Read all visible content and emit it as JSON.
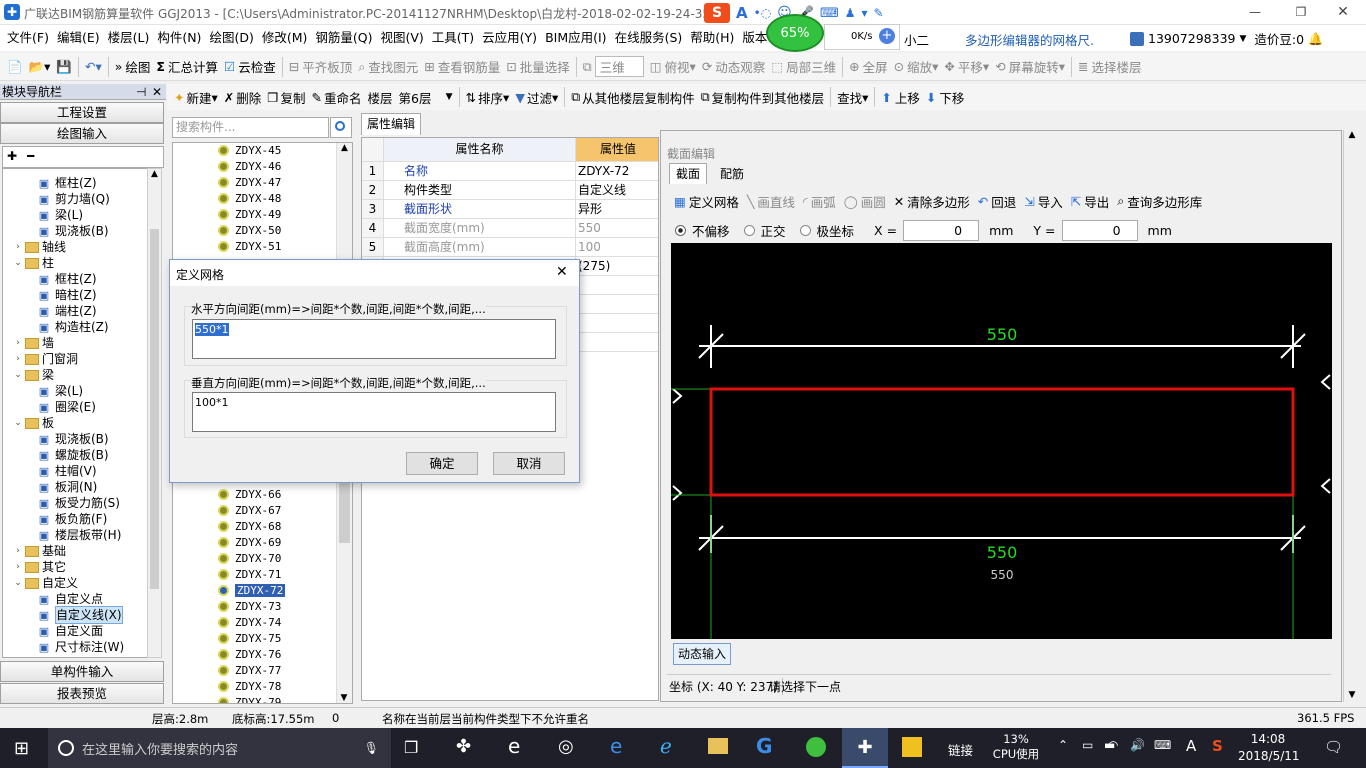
{
  "window": {
    "title": "广联达BIM钢筋算量软件 GGJ2013 - [C:\\Users\\Administrator.PC-20141127NRHM\\Desktop\\白龙村-2018-02-02-19-24-35"
  },
  "overlay": {
    "net_percent": "65%",
    "net_speed": "0K/s",
    "right_text": "多边形编辑器的网格尺.",
    "assistant": "小二"
  },
  "menu": [
    "文件(F)",
    "编辑(E)",
    "楼层(L)",
    "构件(N)",
    "绘图(D)",
    "修改(M)",
    "钢筋量(Q)",
    "视图(V)",
    "工具(T)",
    "云应用(Y)",
    "BIM应用(I)",
    "在线服务(S)",
    "帮助(H)",
    "版本号(B"
  ],
  "account": {
    "phone": "13907298339",
    "price_label": "造价豆:0"
  },
  "toolbar1": {
    "draw": "绘图",
    "sum": "汇总计算",
    "cloud": "云检查",
    "align": "平齐板顶",
    "find": "查找图元",
    "view_steel": "查看钢筋量",
    "batch": "批量选择",
    "view3d": "三维",
    "topview": "俯视",
    "dynamic": "动态观察",
    "local3d": "局部三维",
    "fullscreen": "全屏",
    "zoom": "缩放",
    "pan": "平移",
    "rotate": "屏幕旋转",
    "select_floor": "选择楼层"
  },
  "toolbar2": {
    "new": "新建",
    "delete": "删除",
    "copy": "复制",
    "rename": "重命名",
    "floor_label": "楼层",
    "floor_value": "第6层",
    "sort": "排序",
    "filter": "过滤",
    "copy_from": "从其他楼层复制构件",
    "copy_to": "复制构件到其他楼层",
    "find": "查找",
    "up": "上移",
    "down": "下移"
  },
  "nav": {
    "header": "模块导航栏",
    "btn_settings": "工程设置",
    "btn_draw": "绘图输入",
    "btn_single": "单构件输入",
    "btn_report": "报表预览",
    "tree": [
      {
        "level": 2,
        "label": "框柱(Z)",
        "icon": "column-icon"
      },
      {
        "level": 2,
        "label": "剪力墙(Q)",
        "icon": "wall-icon"
      },
      {
        "level": 2,
        "label": "梁(L)",
        "icon": "beam-icon"
      },
      {
        "level": 2,
        "label": "现浇板(B)",
        "icon": "slab-icon"
      },
      {
        "level": 1,
        "label": "轴线",
        "exp": "›"
      },
      {
        "level": 1,
        "label": "柱",
        "exp": "⌄"
      },
      {
        "level": 2,
        "label": "框柱(Z)",
        "icon": "column-icon"
      },
      {
        "level": 2,
        "label": "暗柱(Z)",
        "icon": "column-icon"
      },
      {
        "level": 2,
        "label": "端柱(Z)",
        "icon": "column-icon"
      },
      {
        "level": 2,
        "label": "构造柱(Z)",
        "icon": "column-icon"
      },
      {
        "level": 1,
        "label": "墙",
        "exp": "›"
      },
      {
        "level": 1,
        "label": "门窗洞",
        "exp": "›"
      },
      {
        "level": 1,
        "label": "梁",
        "exp": "⌄"
      },
      {
        "level": 2,
        "label": "梁(L)",
        "icon": "beam-icon"
      },
      {
        "level": 2,
        "label": "圈梁(E)",
        "icon": "beam-icon"
      },
      {
        "level": 1,
        "label": "板",
        "exp": "⌄"
      },
      {
        "level": 2,
        "label": "现浇板(B)",
        "icon": "slab-icon"
      },
      {
        "level": 2,
        "label": "螺旋板(B)",
        "icon": "slab-icon"
      },
      {
        "level": 2,
        "label": "柱帽(V)",
        "icon": "cap-icon"
      },
      {
        "level": 2,
        "label": "板洞(N)",
        "icon": "hole-icon"
      },
      {
        "level": 2,
        "label": "板受力筋(S)",
        "icon": "rebar-icon"
      },
      {
        "level": 2,
        "label": "板负筋(F)",
        "icon": "rebar-icon"
      },
      {
        "level": 2,
        "label": "楼层板带(H)",
        "icon": "strip-icon"
      },
      {
        "level": 1,
        "label": "基础",
        "exp": "›"
      },
      {
        "level": 1,
        "label": "其它",
        "exp": "›"
      },
      {
        "level": 1,
        "label": "自定义",
        "exp": "⌄"
      },
      {
        "level": 2,
        "label": "自定义点",
        "icon": "point-icon"
      },
      {
        "level": 2,
        "label": "自定义线(X)",
        "icon": "line-icon",
        "selected": true
      },
      {
        "level": 2,
        "label": "自定义面",
        "icon": "face-icon"
      },
      {
        "level": 2,
        "label": "尺寸标注(W)",
        "icon": "dimension-icon"
      }
    ]
  },
  "components": {
    "search_placeholder": "搜索构件...",
    "top_items": [
      "ZDYX-45",
      "ZDYX-46",
      "ZDYX-47",
      "ZDYX-48",
      "ZDYX-49",
      "ZDYX-50",
      "ZDYX-51"
    ],
    "bottom_items": [
      "ZDYX-66",
      "ZDYX-67",
      "ZDYX-68",
      "ZDYX-69",
      "ZDYX-70",
      "ZDYX-71",
      "ZDYX-72",
      "ZDYX-73",
      "ZDYX-74",
      "ZDYX-75",
      "ZDYX-76",
      "ZDYX-77",
      "ZDYX-78",
      "ZDYX-79"
    ],
    "selected": "ZDYX-72"
  },
  "props": {
    "tab": "属性编辑",
    "col_name": "属性名称",
    "col_value": "属性值",
    "rows": [
      {
        "n": "1",
        "k": "名称",
        "v": "ZDYX-72",
        "blue": true
      },
      {
        "n": "2",
        "k": "构件类型",
        "v": "自定义线",
        "blue": false
      },
      {
        "n": "3",
        "k": "截面形状",
        "v": "异形",
        "blue": true
      },
      {
        "n": "4",
        "k": "截面宽度(mm)",
        "v": "550",
        "gray": true
      },
      {
        "n": "5",
        "k": "截面高度(mm)",
        "v": "100",
        "gray": true
      },
      {
        "n": "",
        "k": "",
        "v": "(275)"
      }
    ]
  },
  "section_editor": {
    "title": "截面编辑",
    "tabs": [
      "截面",
      "配筋"
    ],
    "tools": {
      "define_grid": "定义网格",
      "draw_line": "画直线",
      "draw_arc": "画弧",
      "draw_circle": "画圆",
      "clear": "清除多边形",
      "undo": "回退",
      "import": "导入",
      "export": "导出",
      "query": "查询多边形库"
    },
    "modes": [
      "不偏移",
      "正交",
      "极坐标"
    ],
    "x_label": "X =",
    "x_value": "0",
    "y_label": "Y =",
    "y_value": "0",
    "unit": "mm",
    "dim_top": "550",
    "dim_bottom": "550",
    "dim_bottom_sub": "550",
    "dynamic_input": "动态输入",
    "coord": "坐标 (X: 40 Y: 237)",
    "prompt": "请选择下一点"
  },
  "dialog": {
    "title": "定义网格",
    "h_label": "水平方向间距(mm)=>间距*个数,间距,间距*个数,间距,...",
    "h_value": "550*1",
    "v_label": "垂直方向间距(mm)=>间距*个数,间距,间距*个数,间距,...",
    "v_value": "100*1",
    "ok": "确定",
    "cancel": "取消"
  },
  "status": {
    "floor_height": "层高:2.8m",
    "bottom_elev": "底标高:17.55m",
    "zero": "0",
    "message": "名称在当前层当前构件类型下不允许重名",
    "fps": "361.5 FPS"
  },
  "taskbar": {
    "search_placeholder": "在这里输入你要搜索的内容",
    "link": "链接",
    "cpu_percent": "13%",
    "cpu_label": "CPU使用",
    "ime": "A",
    "time": "14:08",
    "date": "2018/5/11"
  },
  "colors": {
    "accent_blue": "#2f5fb3",
    "polygon_red": "#e01010",
    "dim_green": "#22dd22",
    "prop_header_orange": "#f5c46c"
  }
}
